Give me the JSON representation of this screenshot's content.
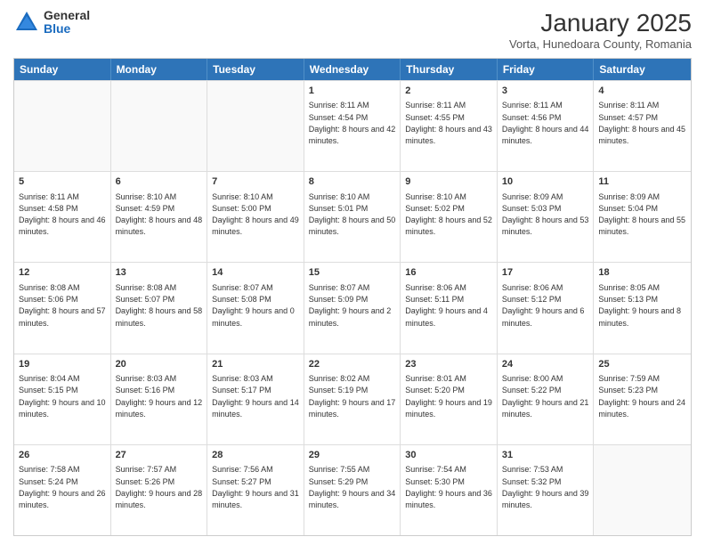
{
  "logo": {
    "general": "General",
    "blue": "Blue"
  },
  "title": "January 2025",
  "subtitle": "Vorta, Hunedoara County, Romania",
  "days_of_week": [
    "Sunday",
    "Monday",
    "Tuesday",
    "Wednesday",
    "Thursday",
    "Friday",
    "Saturday"
  ],
  "weeks": [
    [
      {
        "day": "",
        "empty": true
      },
      {
        "day": "",
        "empty": true
      },
      {
        "day": "",
        "empty": true
      },
      {
        "day": "1",
        "sunrise": "8:11 AM",
        "sunset": "4:54 PM",
        "daylight": "8 hours and 42 minutes."
      },
      {
        "day": "2",
        "sunrise": "8:11 AM",
        "sunset": "4:55 PM",
        "daylight": "8 hours and 43 minutes."
      },
      {
        "day": "3",
        "sunrise": "8:11 AM",
        "sunset": "4:56 PM",
        "daylight": "8 hours and 44 minutes."
      },
      {
        "day": "4",
        "sunrise": "8:11 AM",
        "sunset": "4:57 PM",
        "daylight": "8 hours and 45 minutes."
      }
    ],
    [
      {
        "day": "5",
        "sunrise": "8:11 AM",
        "sunset": "4:58 PM",
        "daylight": "8 hours and 46 minutes."
      },
      {
        "day": "6",
        "sunrise": "8:10 AM",
        "sunset": "4:59 PM",
        "daylight": "8 hours and 48 minutes."
      },
      {
        "day": "7",
        "sunrise": "8:10 AM",
        "sunset": "5:00 PM",
        "daylight": "8 hours and 49 minutes."
      },
      {
        "day": "8",
        "sunrise": "8:10 AM",
        "sunset": "5:01 PM",
        "daylight": "8 hours and 50 minutes."
      },
      {
        "day": "9",
        "sunrise": "8:10 AM",
        "sunset": "5:02 PM",
        "daylight": "8 hours and 52 minutes."
      },
      {
        "day": "10",
        "sunrise": "8:09 AM",
        "sunset": "5:03 PM",
        "daylight": "8 hours and 53 minutes."
      },
      {
        "day": "11",
        "sunrise": "8:09 AM",
        "sunset": "5:04 PM",
        "daylight": "8 hours and 55 minutes."
      }
    ],
    [
      {
        "day": "12",
        "sunrise": "8:08 AM",
        "sunset": "5:06 PM",
        "daylight": "8 hours and 57 minutes."
      },
      {
        "day": "13",
        "sunrise": "8:08 AM",
        "sunset": "5:07 PM",
        "daylight": "8 hours and 58 minutes."
      },
      {
        "day": "14",
        "sunrise": "8:07 AM",
        "sunset": "5:08 PM",
        "daylight": "9 hours and 0 minutes."
      },
      {
        "day": "15",
        "sunrise": "8:07 AM",
        "sunset": "5:09 PM",
        "daylight": "9 hours and 2 minutes."
      },
      {
        "day": "16",
        "sunrise": "8:06 AM",
        "sunset": "5:11 PM",
        "daylight": "9 hours and 4 minutes."
      },
      {
        "day": "17",
        "sunrise": "8:06 AM",
        "sunset": "5:12 PM",
        "daylight": "9 hours and 6 minutes."
      },
      {
        "day": "18",
        "sunrise": "8:05 AM",
        "sunset": "5:13 PM",
        "daylight": "9 hours and 8 minutes."
      }
    ],
    [
      {
        "day": "19",
        "sunrise": "8:04 AM",
        "sunset": "5:15 PM",
        "daylight": "9 hours and 10 minutes."
      },
      {
        "day": "20",
        "sunrise": "8:03 AM",
        "sunset": "5:16 PM",
        "daylight": "9 hours and 12 minutes."
      },
      {
        "day": "21",
        "sunrise": "8:03 AM",
        "sunset": "5:17 PM",
        "daylight": "9 hours and 14 minutes."
      },
      {
        "day": "22",
        "sunrise": "8:02 AM",
        "sunset": "5:19 PM",
        "daylight": "9 hours and 17 minutes."
      },
      {
        "day": "23",
        "sunrise": "8:01 AM",
        "sunset": "5:20 PM",
        "daylight": "9 hours and 19 minutes."
      },
      {
        "day": "24",
        "sunrise": "8:00 AM",
        "sunset": "5:22 PM",
        "daylight": "9 hours and 21 minutes."
      },
      {
        "day": "25",
        "sunrise": "7:59 AM",
        "sunset": "5:23 PM",
        "daylight": "9 hours and 24 minutes."
      }
    ],
    [
      {
        "day": "26",
        "sunrise": "7:58 AM",
        "sunset": "5:24 PM",
        "daylight": "9 hours and 26 minutes."
      },
      {
        "day": "27",
        "sunrise": "7:57 AM",
        "sunset": "5:26 PM",
        "daylight": "9 hours and 28 minutes."
      },
      {
        "day": "28",
        "sunrise": "7:56 AM",
        "sunset": "5:27 PM",
        "daylight": "9 hours and 31 minutes."
      },
      {
        "day": "29",
        "sunrise": "7:55 AM",
        "sunset": "5:29 PM",
        "daylight": "9 hours and 34 minutes."
      },
      {
        "day": "30",
        "sunrise": "7:54 AM",
        "sunset": "5:30 PM",
        "daylight": "9 hours and 36 minutes."
      },
      {
        "day": "31",
        "sunrise": "7:53 AM",
        "sunset": "5:32 PM",
        "daylight": "9 hours and 39 minutes."
      },
      {
        "day": "",
        "empty": true
      }
    ]
  ]
}
